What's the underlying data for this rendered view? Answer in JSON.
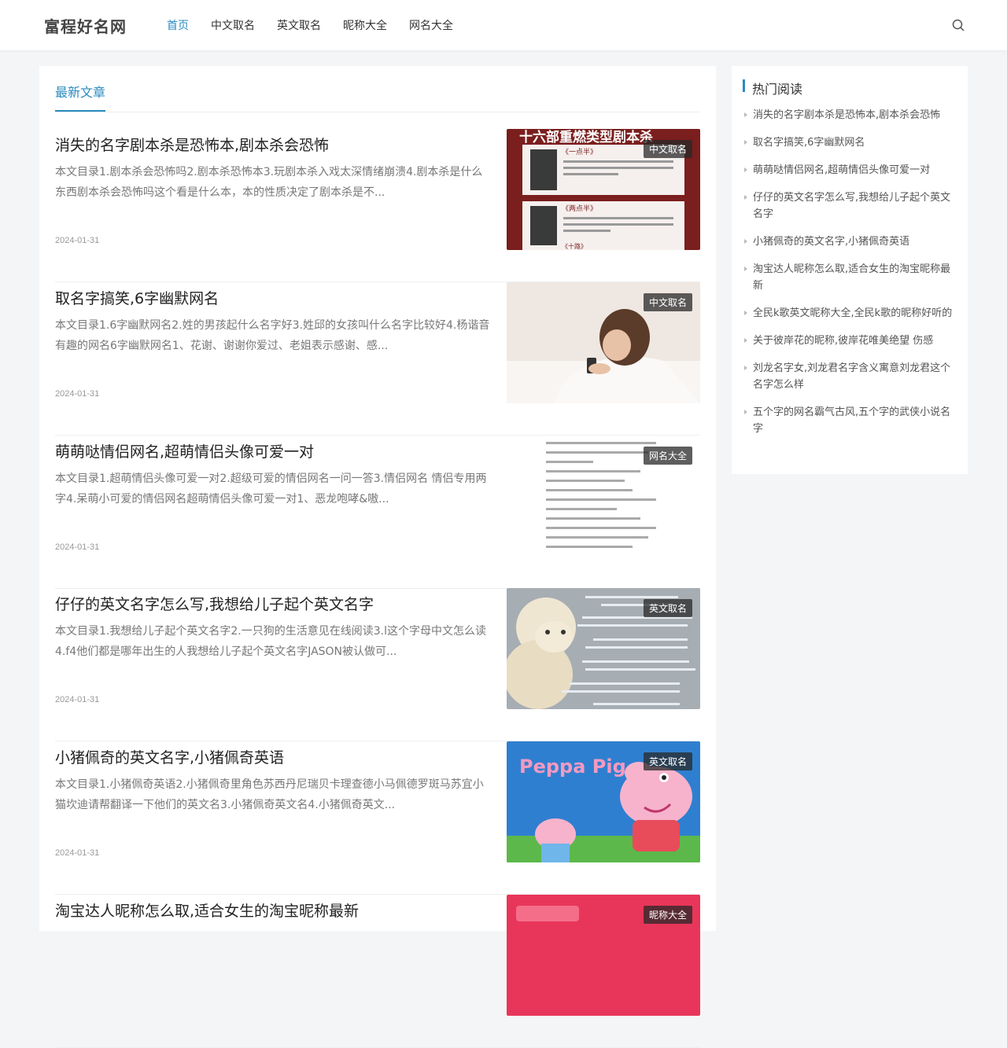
{
  "site": {
    "logo": "富程好名网"
  },
  "nav": [
    {
      "label": "首页",
      "active": true
    },
    {
      "label": "中文取名",
      "active": false
    },
    {
      "label": "英文取名",
      "active": false
    },
    {
      "label": "昵称大全",
      "active": false
    },
    {
      "label": "网名大全",
      "active": false
    }
  ],
  "main": {
    "section_title": "最新文章",
    "articles": [
      {
        "title": "消失的名字剧本杀是恐怖本,剧本杀会恐怖",
        "summary": "本文目录1.剧本杀会恐怖吗2.剧本杀恐怖本3.玩剧本杀入戏太深情绪崩溃4.剧本杀是什么东西剧本杀会恐怖吗这个看是什么本，本的性质决定了剧本杀是不...",
        "date": "2024-01-31",
        "category": "中文取名"
      },
      {
        "title": "取名字搞笑,6字幽默网名",
        "summary": "本文目录1.6字幽默网名2.姓的男孩起什么名字好3.姓邱的女孩叫什么名字比较好4.杨谐音有趣的网名6字幽默网名1、花谢、谢谢你爱过、老姐表示感谢、感...",
        "date": "2024-01-31",
        "category": "中文取名"
      },
      {
        "title": "萌萌哒情侣网名,超萌情侣头像可爱一对",
        "summary": "本文目录1.超萌情侣头像可爱一对2.超级可爱的情侣网名一问一答3.情侣网名 情侣专用两字4.呆萌小可爱的情侣网名超萌情侣头像可爱一对1、恶龙咆哮&嗷...",
        "date": "2024-01-31",
        "category": "网名大全"
      },
      {
        "title": "仔仔的英文名字怎么写,我想给儿子起个英文名字",
        "summary": "本文目录1.我想给儿子起个英文名字2.一只狗的生活意见在线阅读3.l这个字母中文怎么读4.f4他们都是哪年出生的人我想给儿子起个英文名字JASON被认做可...",
        "date": "2024-01-31",
        "category": "英文取名"
      },
      {
        "title": "小猪佩奇的英文名字,小猪佩奇英语",
        "summary": "本文目录1.小猪佩奇英语2.小猪佩奇里角色苏西丹尼瑞贝卡理查德小马佩德罗斑马苏宜小猫坎迪请帮翻译一下他们的英文名3.小猪佩奇英文名4.小猪佩奇英文...",
        "date": "2024-01-31",
        "category": "英文取名"
      },
      {
        "title": "淘宝达人昵称怎么取,适合女生的淘宝昵称最新",
        "summary": "",
        "date": "",
        "category": "昵称大全"
      }
    ]
  },
  "sidebar": {
    "title": "热门阅读",
    "items": [
      "消失的名字剧本杀是恐怖本,剧本杀会恐怖",
      "取名字搞笑,6字幽默网名",
      "萌萌哒情侣网名,超萌情侣头像可爱一对",
      "仔仔的英文名字怎么写,我想给儿子起个英文名字",
      "小猪佩奇的英文名字,小猪佩奇英语",
      "淘宝达人昵称怎么取,适合女生的淘宝昵称最新",
      "全民k歌英文昵称大全,全民k歌的昵称好听的",
      "关于彼岸花的昵称,彼岸花唯美绝望 伤感",
      "刘龙名字女,刘龙君名字含义寓意刘龙君这个名字怎么样",
      "五个字的网名霸气古风,五个字的武侠小说名字"
    ]
  },
  "thumb_art": {
    "t1": {
      "heading": "十六部重燃类型剧本杀",
      "a": "《一点半》",
      "b": "《两点半》",
      "c": "《十路》"
    },
    "t5": {
      "logo": "Peppa Pig"
    }
  },
  "colors": {
    "accent": "#2a8bbf"
  }
}
